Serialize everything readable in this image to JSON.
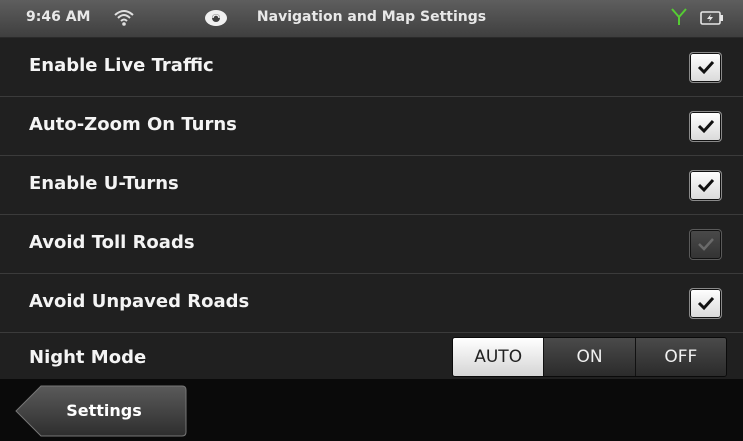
{
  "status_bar": {
    "time": "9:46 AM",
    "title": "Navigation and Map Settings",
    "icons": [
      "wifi-icon",
      "sync-icon",
      "signal-icon",
      "battery-charging-icon"
    ]
  },
  "settings": {
    "items": [
      {
        "label": "Enable Live Traffic",
        "checked": true,
        "enabled": true
      },
      {
        "label": "Auto-Zoom On Turns",
        "checked": true,
        "enabled": true
      },
      {
        "label": "Enable U-Turns",
        "checked": true,
        "enabled": true
      },
      {
        "label": "Avoid Toll Roads",
        "checked": true,
        "enabled": false
      },
      {
        "label": "Avoid Unpaved Roads",
        "checked": true,
        "enabled": true
      }
    ],
    "night_mode": {
      "label": "Night Mode",
      "options": [
        "AUTO",
        "ON",
        "OFF"
      ],
      "selected": "AUTO"
    }
  },
  "bottom_bar": {
    "back_label": "Settings"
  },
  "colors": {
    "accent": "#ffffff",
    "signal": "#55cc33"
  }
}
